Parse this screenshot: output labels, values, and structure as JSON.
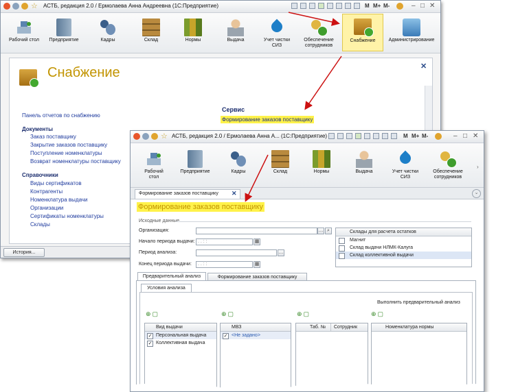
{
  "back_window": {
    "title": "АСТБ, редакция 2.0 / Ермолаева Анна Андреевна  (1С:Предприятие)",
    "title_right_labels": [
      "M",
      "M+",
      "M-"
    ],
    "toolbar": [
      {
        "label": "Рабочий стол",
        "icon": "desktop-icon"
      },
      {
        "label": "Предприятие",
        "icon": "book-icon"
      },
      {
        "label": "Кадры",
        "icon": "people-icon"
      },
      {
        "label": "Склад",
        "icon": "shelf-icon"
      },
      {
        "label": "Нормы",
        "icon": "binders-icon"
      },
      {
        "label": "Выдача",
        "icon": "worker-icon"
      },
      {
        "label": "Учет чистки СИЗ",
        "icon": "drop-icon"
      },
      {
        "label": "Обеспечение сотрудников",
        "icon": "user-add-icon"
      },
      {
        "label": "Снабжение",
        "icon": "box-icon"
      },
      {
        "label": "Администрирование",
        "icon": "admin-icon"
      }
    ],
    "page_title": "Снабжение",
    "panel_link": "Панель отчетов по снабжению",
    "documents": {
      "heading": "Документы",
      "items": [
        "Заказ поставщику",
        "Закрытие заказов поставщику",
        "Поступление номенклатуры",
        "Возврат номенклатуры поставщику"
      ]
    },
    "references": {
      "heading": "Справочники",
      "items": [
        "Виды сертификатов",
        "Контрагенты",
        "Номенклатура выдачи",
        "Организации",
        "Сертификаты номенклатуры",
        "Склады"
      ]
    },
    "service": {
      "heading": "Сервис",
      "item": "Формирование заказов поставщику"
    },
    "history_button": "История..."
  },
  "front_window": {
    "title": "АСТБ, редакция 2.0 / Ермолаева Анна А...  (1С:Предприятие)",
    "title_right_labels": [
      "M",
      "M+",
      "M-"
    ],
    "toolbar": [
      {
        "label": "Рабочий стол",
        "icon": "desktop-icon"
      },
      {
        "label": "Предприятие",
        "icon": "book-icon"
      },
      {
        "label": "Кадры",
        "icon": "people-icon"
      },
      {
        "label": "Склад",
        "icon": "shelf-icon"
      },
      {
        "label": "Нормы",
        "icon": "binders-icon"
      },
      {
        "label": "Выдача",
        "icon": "worker-icon"
      },
      {
        "label": "Учет чистки СИЗ",
        "icon": "drop-icon"
      },
      {
        "label": "Обеспечение сотрудников",
        "icon": "user-add-icon"
      }
    ],
    "doc_tab": "Формирование заказов поставщику",
    "form_title": "Формирование заказов поставщику",
    "source_group": "Исходные данные",
    "fields": {
      "organization_label": "Организация:",
      "period_start_label": "Начало периода выдачи:",
      "period_start_value": ". .    : :",
      "analysis_period_label": "Период анализа:",
      "period_end_label": "Конец периода выдачи:",
      "period_end_value": ". .    : :"
    },
    "warehouses": {
      "header": "Склады для расчета остатков",
      "items": [
        "Магнит",
        "Склад выдачи НЛМК-Калуга",
        "Склад коллективной выдачи"
      ]
    },
    "tabs": [
      "Предварительный анализ",
      "Формирование заказов поставщику"
    ],
    "sub_tab": "Условия анализа",
    "run_button": "Выполнить предварительный анализ",
    "grid_issue": {
      "header": "Вид выдачи",
      "rows": [
        {
          "label": "Персональная выдача",
          "checked": true
        },
        {
          "label": "Коллективная выдача",
          "checked": true
        }
      ]
    },
    "grid_mvz": {
      "header": "МВЗ",
      "rows": [
        {
          "label": "<Не задано>",
          "checked": true
        }
      ]
    },
    "grid_emp": {
      "header_tab": "Таб. №",
      "header_emp": "Сотрудник"
    },
    "grid_nom": {
      "header": "Номенклатура нормы"
    }
  },
  "colors": {
    "title_gold": "#c29400",
    "highlight": "#fff24a",
    "arrow": "#cc1111",
    "link": "#1f3b9e"
  }
}
